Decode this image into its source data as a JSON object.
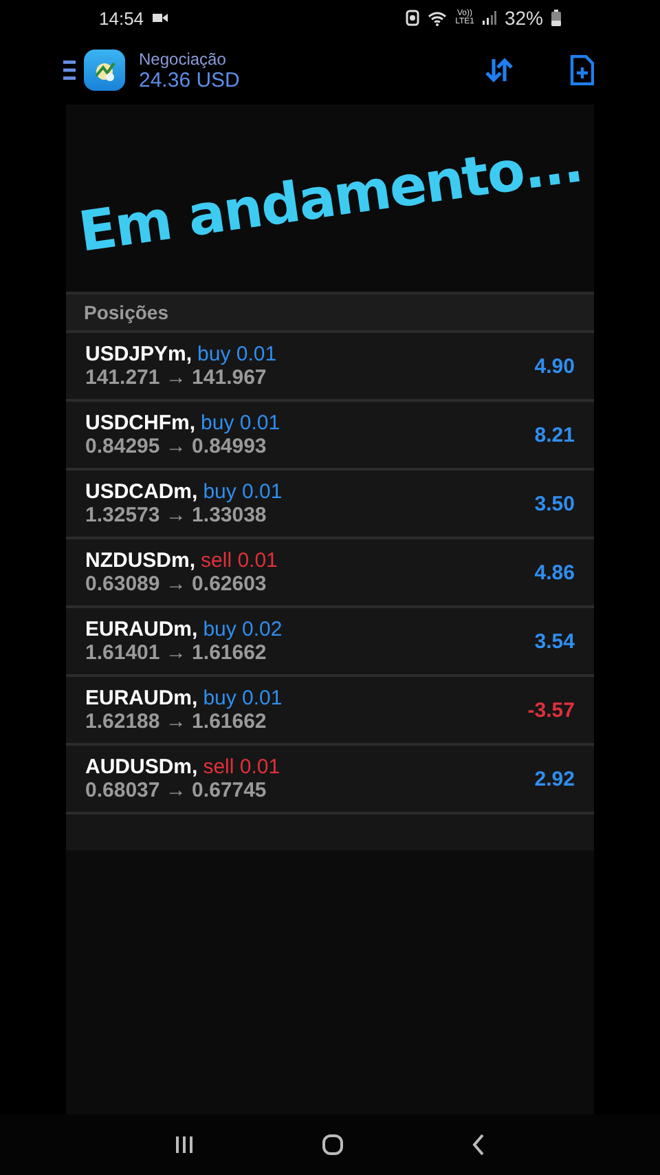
{
  "status_bar": {
    "time": "14:54",
    "network": "Vo))\nLTE1",
    "battery": "32%"
  },
  "app_bar": {
    "title": "Negociação",
    "balance": "24.36 USD"
  },
  "overlay_text": "Em andamento...",
  "positions": {
    "header": "Posições",
    "rows": [
      {
        "symbol": "USDJPYm,",
        "kind": "buy",
        "order": "buy 0.01",
        "prices": "141.271 → 141.967",
        "profit": "4.90",
        "loss": false
      },
      {
        "symbol": "USDCHFm,",
        "kind": "buy",
        "order": "buy 0.01",
        "prices": "0.84295 → 0.84993",
        "profit": "8.21",
        "loss": false
      },
      {
        "symbol": "USDCADm,",
        "kind": "buy",
        "order": "buy 0.01",
        "prices": "1.32573 → 1.33038",
        "profit": "3.50",
        "loss": false
      },
      {
        "symbol": "NZDUSDm,",
        "kind": "sell",
        "order": "sell 0.01",
        "prices": "0.63089 → 0.62603",
        "profit": "4.86",
        "loss": false
      },
      {
        "symbol": "EURAUDm,",
        "kind": "buy",
        "order": "buy 0.02",
        "prices": "1.61401 → 1.61662",
        "profit": "3.54",
        "loss": false
      },
      {
        "symbol": "EURAUDm,",
        "kind": "buy",
        "order": "buy 0.01",
        "prices": "1.62188 → 1.61662",
        "profit": "-3.57",
        "loss": true
      },
      {
        "symbol": "AUDUSDm,",
        "kind": "sell",
        "order": "sell 0.01",
        "prices": "0.68037 → 0.67745",
        "profit": "2.92",
        "loss": false
      }
    ]
  }
}
